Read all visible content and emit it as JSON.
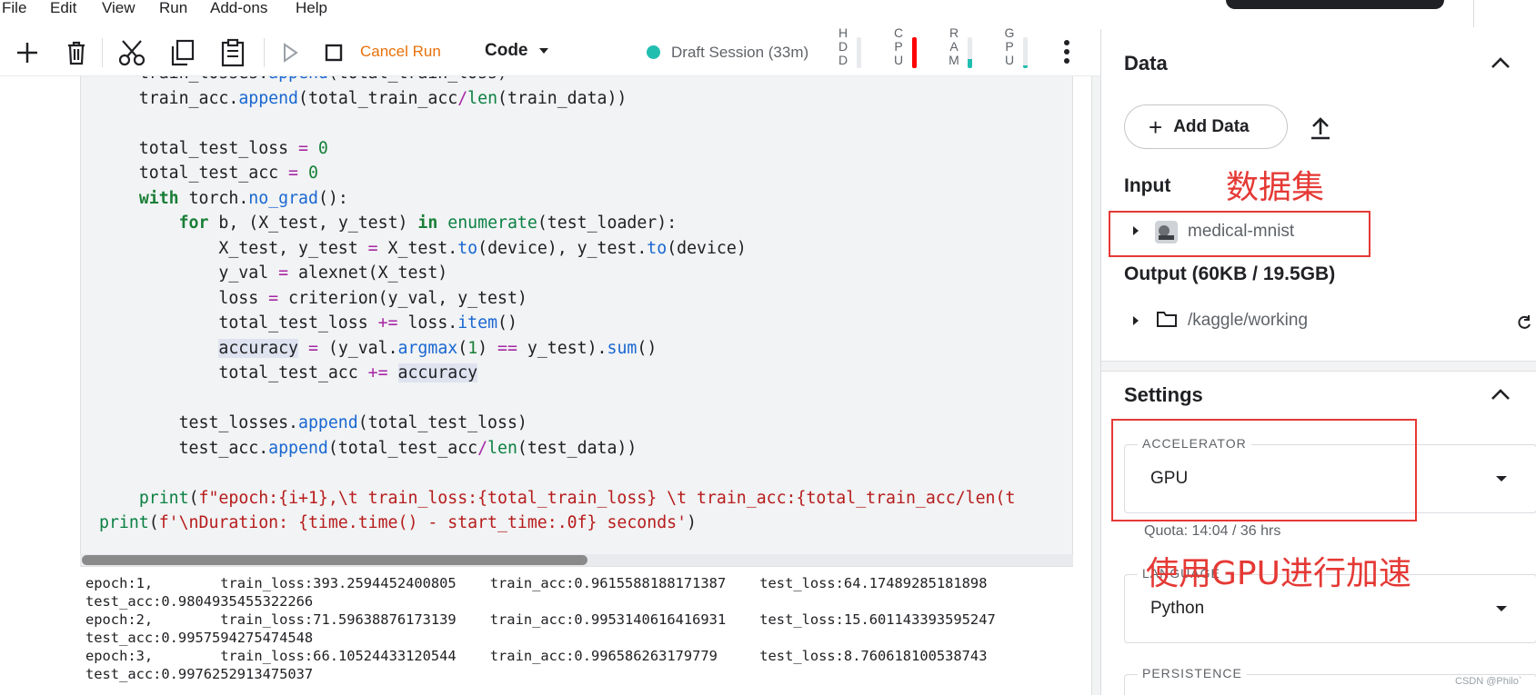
{
  "menu": [
    "File",
    "Edit",
    "View",
    "Run",
    "Add-ons",
    "Help"
  ],
  "toolbar": {
    "cancel_run": "Cancel Run",
    "cell_type": "Code",
    "session": "Draft Session (33m)",
    "meters": [
      {
        "label": "HDD",
        "level": 0.0,
        "color": "#dadce0"
      },
      {
        "label": "CPU",
        "level": 1.0,
        "color": "#ff0000"
      },
      {
        "label": "RAM",
        "level": 0.3,
        "color": "#20beaf"
      },
      {
        "label": "GPU",
        "level": 0.1,
        "color": "#20beaf"
      }
    ]
  },
  "code_lines": [
    "    train_losses.append(total_train_loss)",
    "    train_acc.append(total_train_acc/len(train_data))",
    "",
    "    total_test_loss = 0",
    "    total_test_acc = 0",
    "    with torch.no_grad():",
    "        for b, (X_test, y_test) in enumerate(test_loader):",
    "            X_test, y_test = X_test.to(device), y_test.to(device)",
    "            y_val = alexnet(X_test)",
    "            loss = criterion(y_val, y_test)",
    "            total_test_loss += loss.item()",
    "            accuracy = (y_val.argmax(1) == y_test).sum()",
    "            total_test_acc += accuracy",
    "",
    "        test_losses.append(total_test_loss)",
    "        test_acc.append(total_test_acc/len(test_data))",
    "",
    "    print(f\"epoch:{i+1},\\t train_loss:{total_train_loss} \\t train_acc:{total_train_acc/len(t",
    "print(f'\\nDuration: {time.time() - start_time:.0f} seconds')"
  ],
  "output_lines": [
    "epoch:1,        train_loss:393.2594452400805    train_acc:0.9615588188171387    test_loss:64.17489285181898",
    "test_acc:0.9804935455322266",
    "epoch:2,        train_loss:71.59638876173139    train_acc:0.9953140616416931    test_loss:15.601143393595247",
    "test_acc:0.9957594275474548",
    "epoch:3,        train_loss:66.10524433120544    train_acc:0.996586263179779     test_loss:8.760618100538743",
    "test_acc:0.9976252913475037"
  ],
  "panel": {
    "data_title": "Data",
    "add_data": "Add Data",
    "input_title": "Input",
    "input_item": "medical-mnist",
    "annotation_dataset": "数据集",
    "output_title": "Output (60KB / 19.5GB)",
    "output_item": "/kaggle/working",
    "settings_title": "Settings",
    "accelerator_label": "ACCELERATOR",
    "accelerator_value": "GPU",
    "quota": "Quota: 14:04 / 36 hrs",
    "annotation_gpu": "使用GPU进行加速",
    "language_label": "LANGUAGE",
    "language_value": "Python",
    "persistence_label": "PERSISTENCE"
  },
  "watermark": "CSDN @Philo`"
}
